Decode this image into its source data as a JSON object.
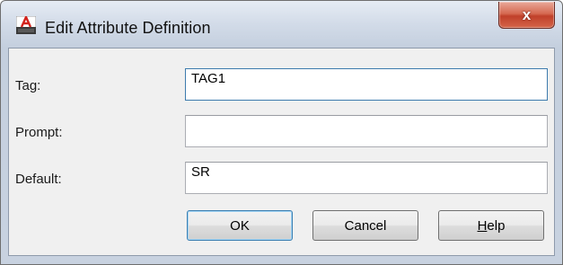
{
  "window": {
    "title": "Edit Attribute Definition",
    "app_icon": "autocad-icon",
    "close_label": "x"
  },
  "fields": {
    "tag": {
      "label": "Tag:",
      "value": "TAG1"
    },
    "prompt": {
      "label": "Prompt:",
      "value": ""
    },
    "default": {
      "label": "Default:",
      "value": "SR"
    }
  },
  "buttons": {
    "ok": "OK",
    "cancel": "Cancel",
    "help_mnemonic": "H",
    "help_rest": "elp"
  },
  "colors": {
    "focus_border": "#3d7bad",
    "close_red": "#c0402a"
  }
}
